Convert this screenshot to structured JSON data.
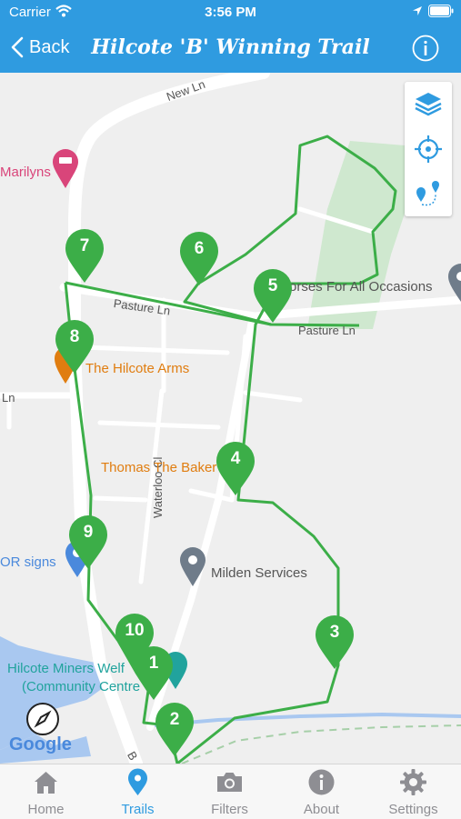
{
  "status_bar": {
    "carrier": "Carrier",
    "time": "3:56 PM"
  },
  "nav": {
    "back_label": "Back",
    "title": "Hilcote 'B' Winning Trail",
    "info_icon": "info-icon"
  },
  "map": {
    "places": {
      "marilyns": "Marilyns",
      "hilcote_arms": "The Hilcote Arms",
      "thomas_baker": "Thomas The Baker",
      "milden_services": "Milden Services",
      "dor_signs": "OR signs",
      "horses": "orses For All Occasions",
      "hilcote_miners_line1": "Hilcote Miners Welf",
      "hilcote_miners_line2": "(Community Centre"
    },
    "streets": {
      "new_ln": "New Ln",
      "pasture_ln_west": "Pasture Ln",
      "pasture_ln_east": "Pasture Ln",
      "waterloo_cl": "Waterloo Cl",
      "ln_left": "Ln",
      "b_road": "B"
    },
    "pins": [
      "1",
      "2",
      "3",
      "4",
      "5",
      "6",
      "7",
      "8",
      "9",
      "10"
    ],
    "attribution": "Google",
    "controls": [
      "layers-icon",
      "locate-icon",
      "route-pins-icon"
    ]
  },
  "tabs": [
    {
      "label": "Home",
      "icon": "home-icon",
      "active": false
    },
    {
      "label": "Trails",
      "icon": "map-pin-icon",
      "active": true
    },
    {
      "label": "Filters",
      "icon": "camera-icon",
      "active": false
    },
    {
      "label": "About",
      "icon": "info-icon",
      "active": false
    },
    {
      "label": "Settings",
      "icon": "gear-icon",
      "active": false
    }
  ],
  "colors": {
    "primary": "#2f9be0",
    "trail_green": "#3cae48",
    "inactive_tab": "#8e8e93",
    "poi_orange": "#e07d10",
    "poi_pink": "#d9457a"
  }
}
